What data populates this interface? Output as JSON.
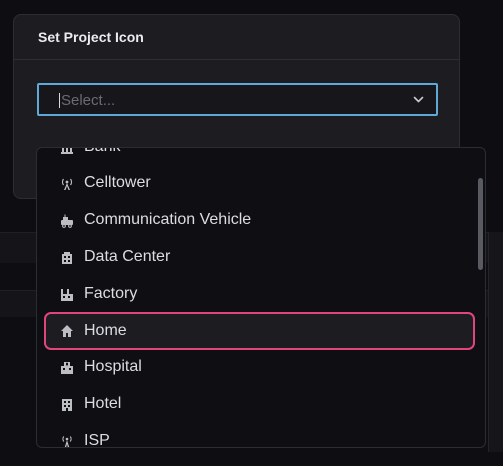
{
  "modal": {
    "title": "Set Project Icon"
  },
  "select": {
    "placeholder": "Select...",
    "value": ""
  },
  "dropdown": {
    "options": [
      {
        "label": "Bank",
        "icon": "bank-icon",
        "state": "partially-visible"
      },
      {
        "label": "Celltower",
        "icon": "celltower-icon"
      },
      {
        "label": "Communication Vehicle",
        "icon": "communication-vehicle-icon"
      },
      {
        "label": "Data Center",
        "icon": "data-center-icon"
      },
      {
        "label": "Factory",
        "icon": "factory-icon"
      },
      {
        "label": "Home",
        "icon": "home-icon",
        "state": "highlighted"
      },
      {
        "label": "Hospital",
        "icon": "hospital-icon"
      },
      {
        "label": "Hotel",
        "icon": "hotel-icon"
      },
      {
        "label": "ISP",
        "icon": "isp-icon",
        "state": "partially-visible"
      }
    ]
  },
  "colors": {
    "focus_border": "#5ea9d9",
    "highlight_border": "#e0467a",
    "modal_bg": "#1c1c21",
    "dropdown_bg": "#0f0f13"
  }
}
